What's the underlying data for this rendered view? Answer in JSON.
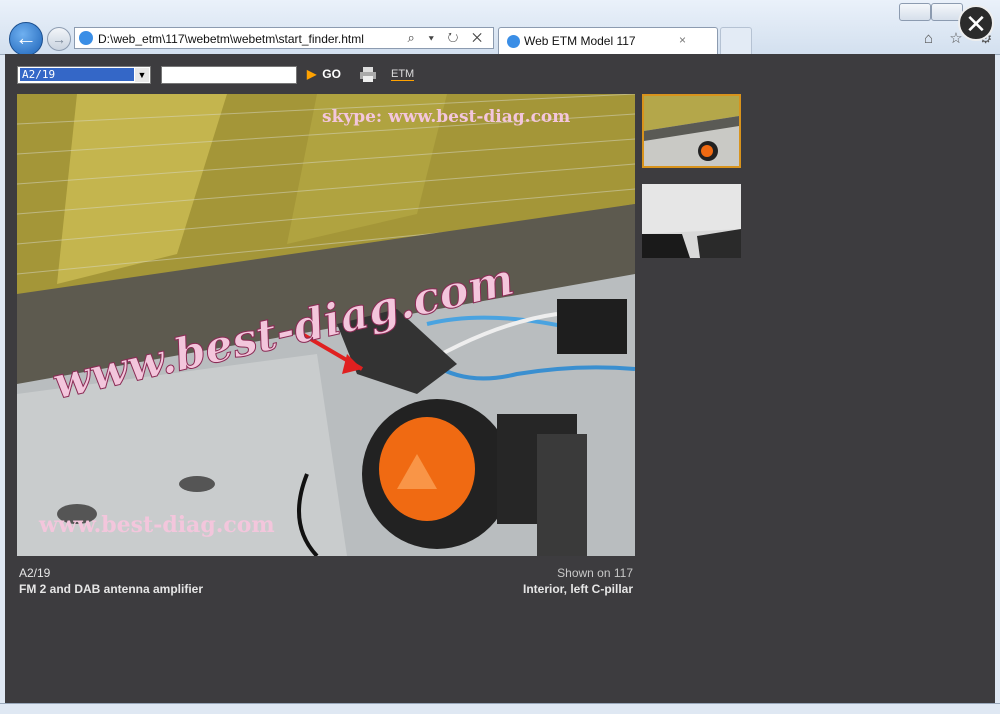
{
  "browser": {
    "address_url": "D:\\web_etm\\117\\webetm\\webetm\\start_finder.html",
    "address_tools": "⌕ ▾ ↻ ✕",
    "tab_title": "Web ETM Model 117",
    "tab_close": "×",
    "back_glyph": "←",
    "forward_glyph": "→",
    "right_icons": "⌂ ☆ ⚙",
    "overlay_close": "✕"
  },
  "toolbar": {
    "component_select_value": "A2/19",
    "select_arrow": "▼",
    "search_value": "",
    "go_label": "GO",
    "go_icon": "▶",
    "etm_label": "ETM"
  },
  "photo": {
    "watermark_top": "skype: www.best-diag.com",
    "watermark_center": "www.best-diag.com",
    "watermark_bottom": "www.best-diag.com"
  },
  "caption": {
    "component_id": "A2/19",
    "component_name": "FM 2 and DAB antenna amplifier",
    "shown_on": "Shown on 117",
    "location": "Interior, left C-pillar"
  },
  "colors": {
    "background": "#3d3c3f",
    "accent": "#ffa200",
    "thumbnail_selected_border": "#d8931c"
  }
}
